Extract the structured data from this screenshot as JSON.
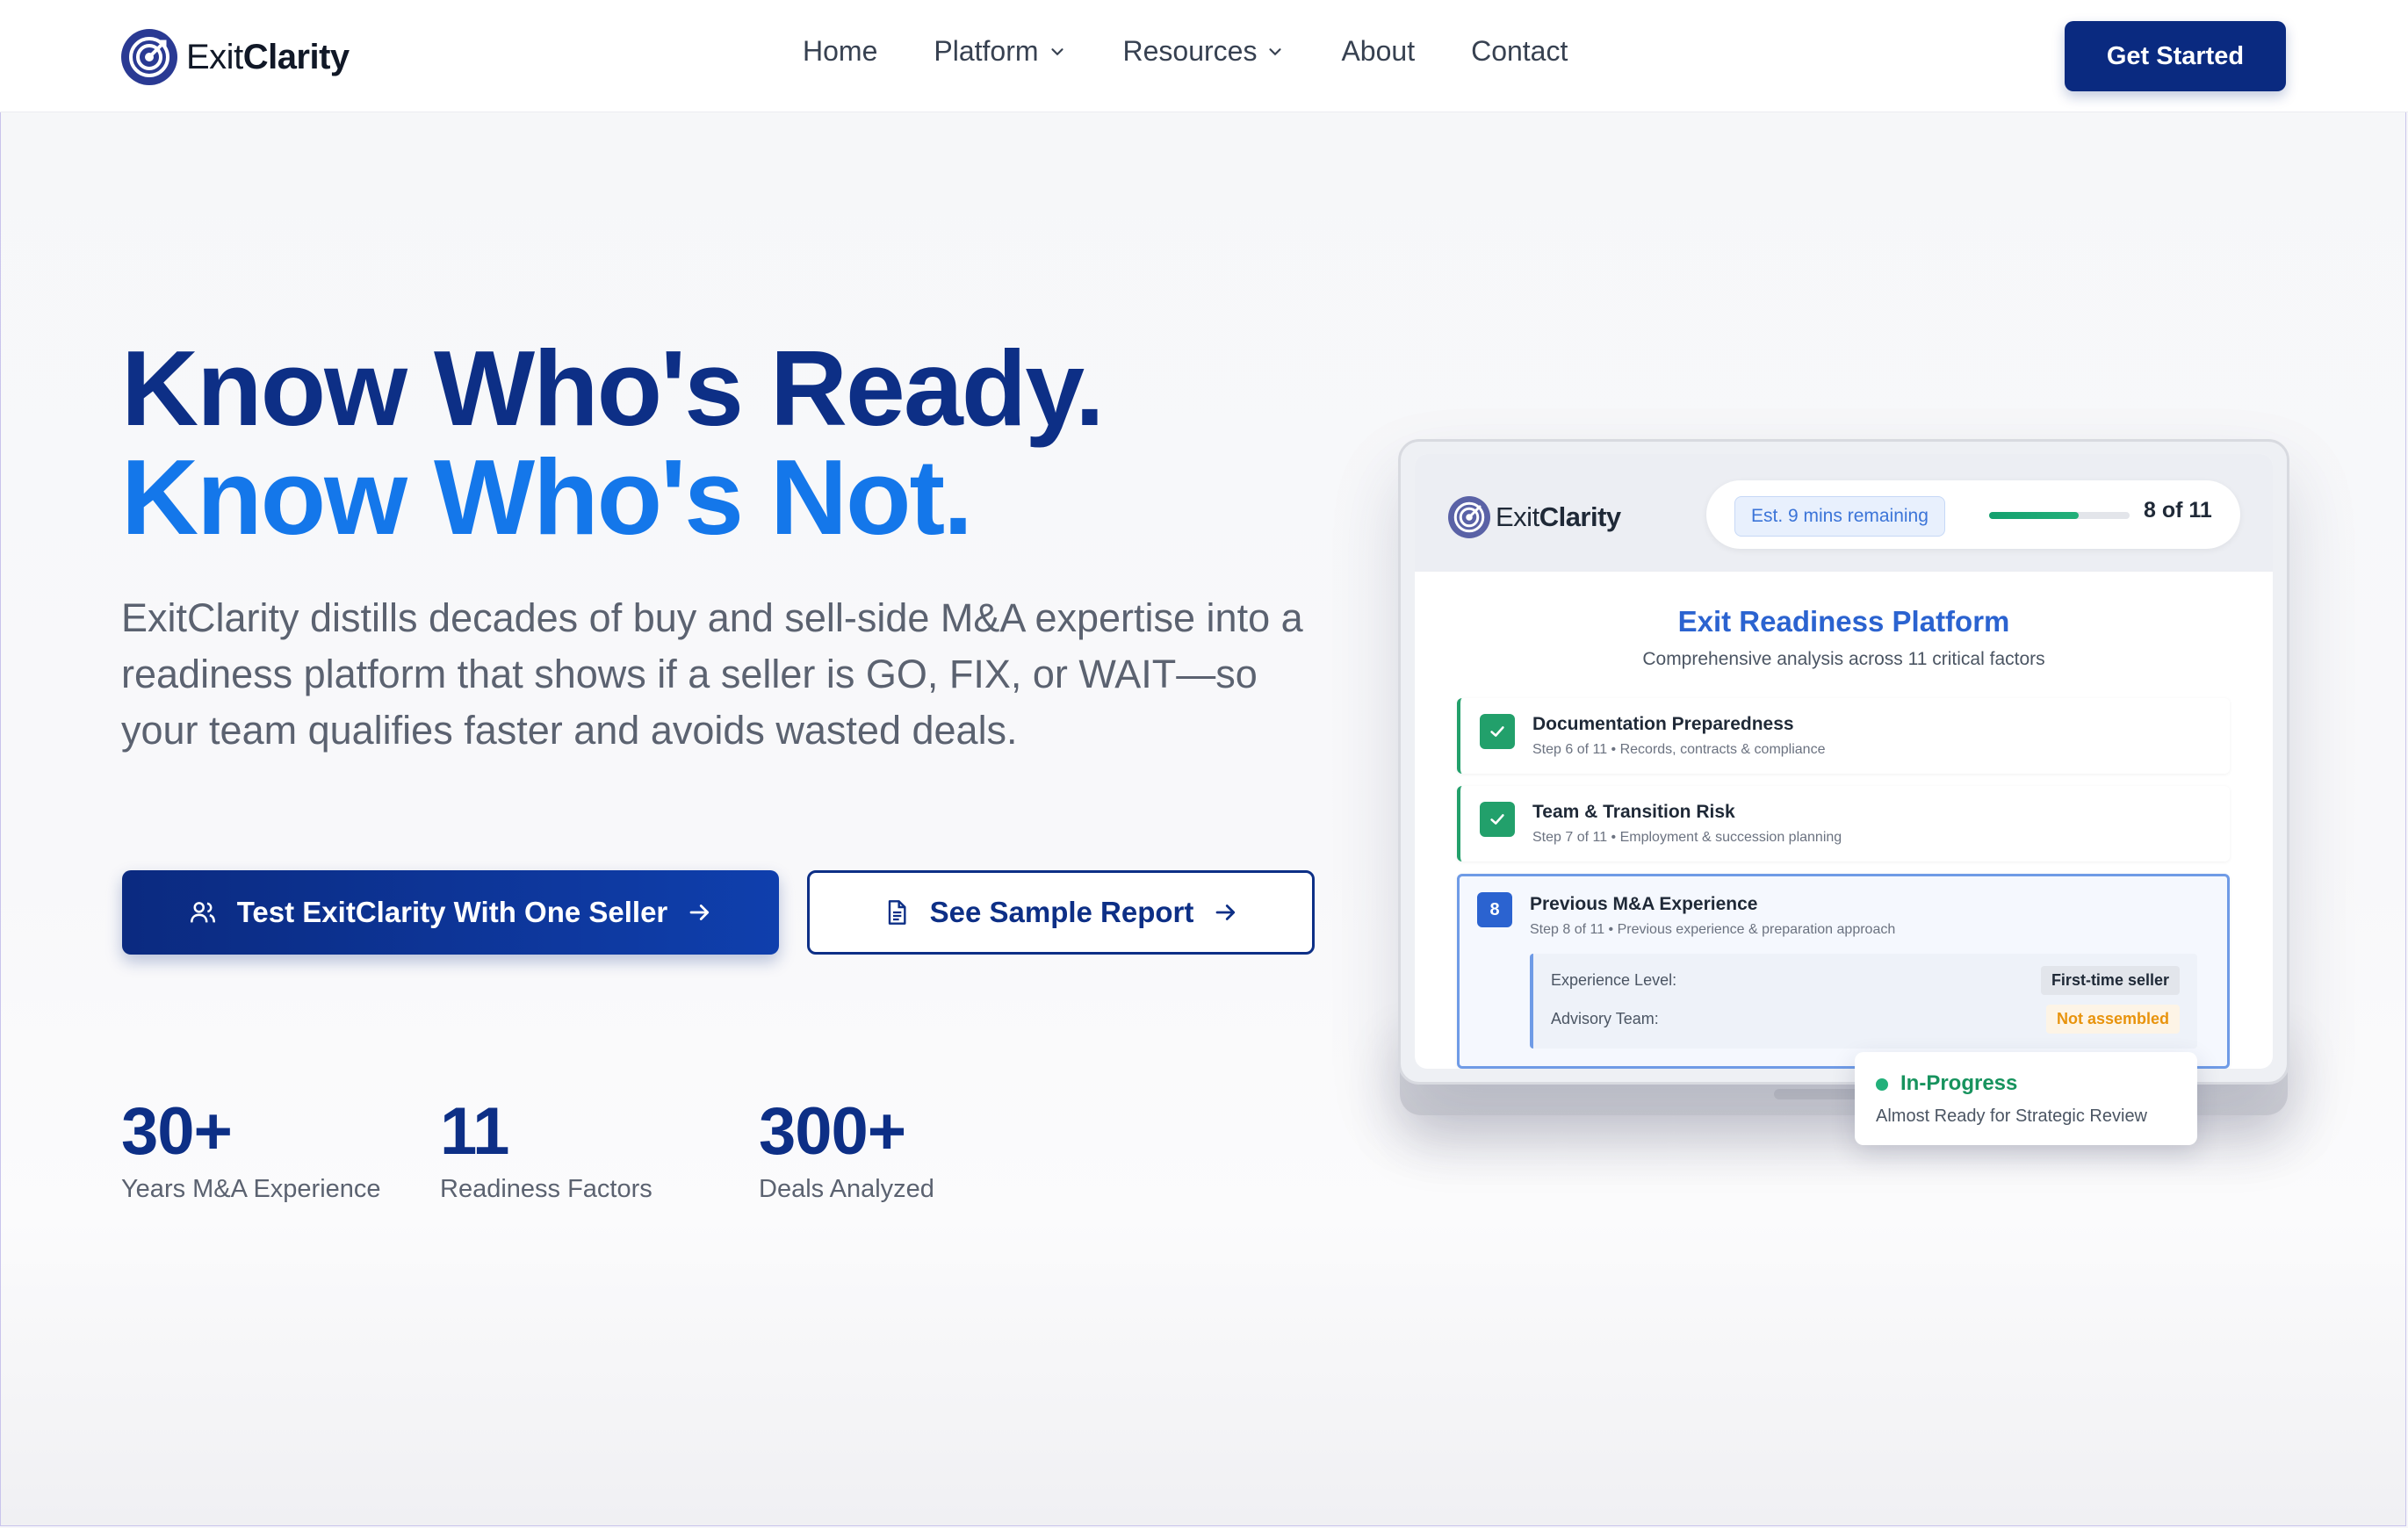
{
  "brand": {
    "name_light": "Exit",
    "name_bold": "Clarity"
  },
  "nav": {
    "items": [
      {
        "label": "Home",
        "dropdown": false
      },
      {
        "label": "Platform",
        "dropdown": true
      },
      {
        "label": "Resources",
        "dropdown": true
      },
      {
        "label": "About",
        "dropdown": false
      },
      {
        "label": "Contact",
        "dropdown": false
      }
    ],
    "cta_label": "Get Started"
  },
  "hero": {
    "title_line1": "Know Who's Ready.",
    "title_line2": "Know Who's Not.",
    "description": "ExitClarity distills decades of buy and sell-side M&A expertise into a readiness platform that shows if a seller is GO, FIX, or WAIT—so your team qualifies faster and avoids wasted deals.",
    "primary_cta": "Test ExitClarity With One Seller",
    "secondary_cta": "See Sample Report"
  },
  "stats": [
    {
      "value": "30+",
      "label": "Years M&A Experience"
    },
    {
      "value": "11",
      "label": "Readiness Factors"
    },
    {
      "value": "300+",
      "label": "Deals Analyzed"
    }
  ],
  "mockup": {
    "est_time": "Est. 9 mins remaining",
    "progress_fraction": 0.64,
    "progress_count": "8 of 11",
    "panel_title": "Exit Readiness Platform",
    "panel_subtitle": "Comprehensive analysis across 11 critical factors",
    "steps": [
      {
        "title": "Documentation Preparedness",
        "subtitle": "Step 6 of 11 • Records, contracts & compliance",
        "status": "done"
      },
      {
        "title": "Team & Transition Risk",
        "subtitle": "Step 7 of 11 • Employment & succession planning",
        "status": "done"
      },
      {
        "number": "8",
        "title": "Previous M&A Experience",
        "subtitle": "Step 8 of 11 • Previous experience & preparation approach",
        "status": "active",
        "details": [
          {
            "label": "Experience Level:",
            "value": "First-time seller"
          },
          {
            "label": "Advisory Team:",
            "value": "Not assembled"
          }
        ]
      }
    ],
    "status_card": {
      "title": "In-Progress",
      "subtitle": "Almost Ready for Strategic Review"
    }
  },
  "colors": {
    "navy": "#0d2f86",
    "blue": "#1477ea",
    "green": "#22a06b",
    "warn": "#e8930c"
  }
}
